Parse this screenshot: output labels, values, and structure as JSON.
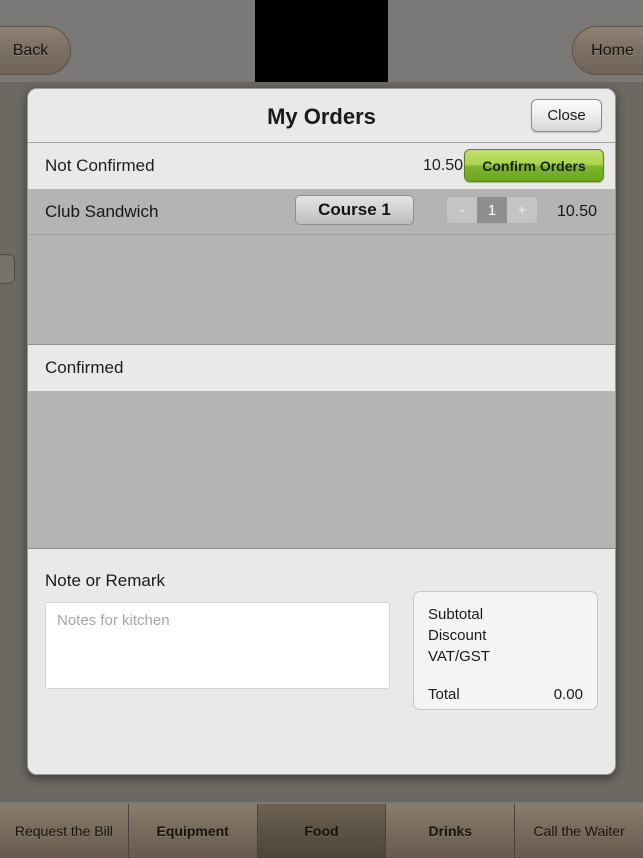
{
  "topbar": {
    "back_label": "Back",
    "home_label": "Home"
  },
  "modal": {
    "title": "My Orders",
    "close_label": "Close",
    "not_confirmed": {
      "label": "Not Confirmed",
      "amount": "10.50",
      "confirm_button_label": "Confirm Orders",
      "items": [
        {
          "name": "Club Sandwich",
          "course_label": "Course 1",
          "decrement_label": "-",
          "quantity": "1",
          "increment_label": "+",
          "price": "10.50"
        }
      ]
    },
    "confirmed": {
      "label": "Confirmed",
      "items": []
    },
    "note": {
      "title": "Note or Remark",
      "placeholder": "Notes for kitchen",
      "value": ""
    },
    "totals": {
      "rows": [
        {
          "label": "Subtotal",
          "value": ""
        },
        {
          "label": "Discount",
          "value": ""
        },
        {
          "label": "VAT/GST",
          "value": ""
        }
      ],
      "total_label": "Total",
      "total_value": "0.00"
    }
  },
  "tabbar": {
    "tabs": [
      {
        "label": "Request the Bill",
        "bold": false,
        "selected": false
      },
      {
        "label": "Equipment",
        "bold": true,
        "selected": false
      },
      {
        "label": "Food",
        "bold": true,
        "selected": true
      },
      {
        "label": "Drinks",
        "bold": true,
        "selected": false
      },
      {
        "label": "Call the Waiter",
        "bold": false,
        "selected": false
      }
    ]
  },
  "colors": {
    "accent_green": "#7db72b",
    "modal_bg": "#e9e9e9",
    "list_bg": "#b4b4b4",
    "chrome_brown": "#7a6e5f"
  }
}
